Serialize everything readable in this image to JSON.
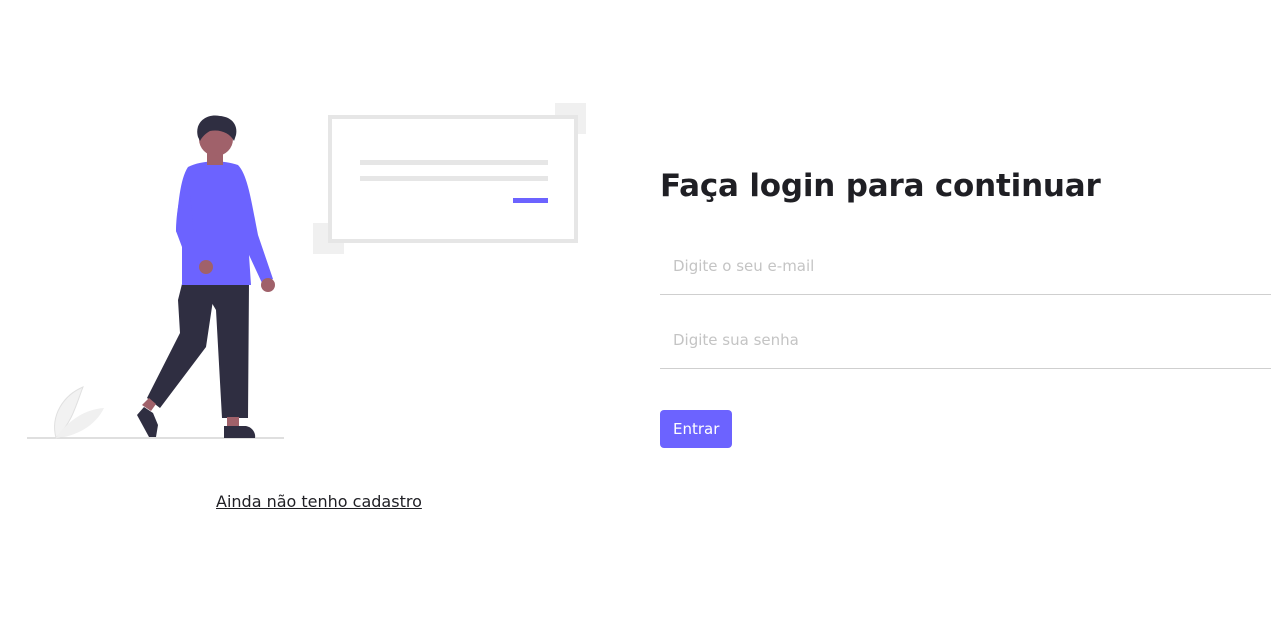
{
  "login": {
    "title": "Faça login para continuar",
    "email_placeholder": "Digite o seu e-mail",
    "password_placeholder": "Digite sua senha",
    "submit_label": "Entrar"
  },
  "signup": {
    "link_label": "Ainda não tenho cadastro"
  },
  "colors": {
    "accent": "#6c63ff",
    "text": "#1f1f24",
    "skin": "#a0616a",
    "pants": "#2f2e41",
    "light_gray": "#e6e6e6"
  },
  "icons": {
    "illustration": "person-walking-illustration"
  }
}
